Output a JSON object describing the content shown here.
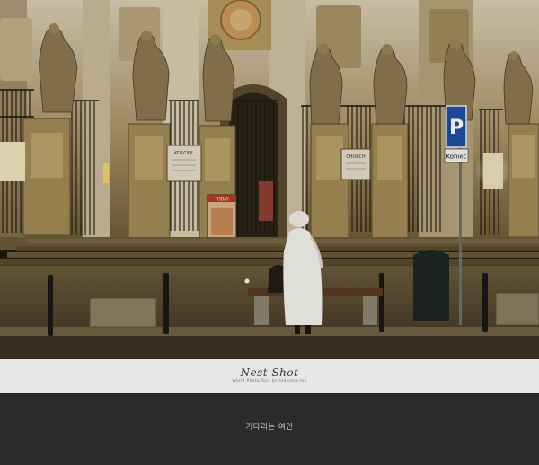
{
  "photo": {
    "sign_koscioł": "KOSCIOL",
    "sign_church": "CHURCH",
    "sign_today": "TODAY",
    "parking_letter": "P",
    "parking_label": "Koniec"
  },
  "watermark": {
    "title": "Nest Shot",
    "subtitle": "World Photo Tour by ludicana lee"
  },
  "caption": "기다리는 여인"
}
